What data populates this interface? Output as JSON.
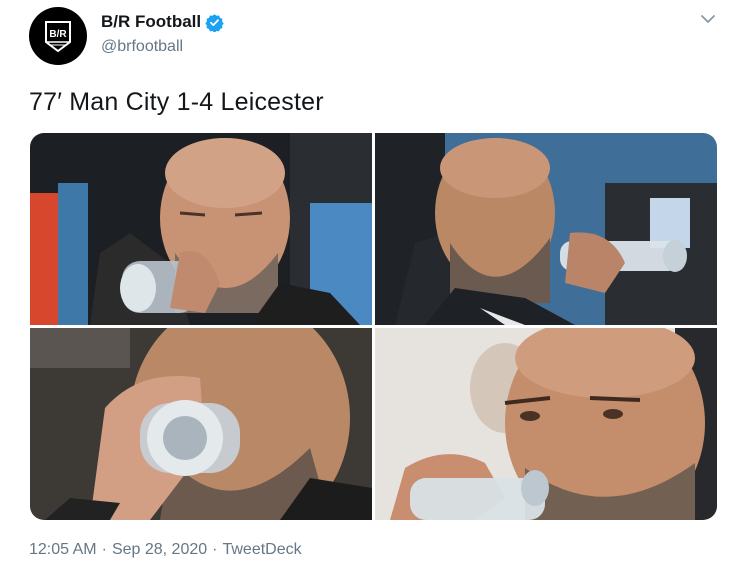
{
  "account": {
    "display_name": "B/R Football",
    "handle": "@brfootball",
    "verified": true,
    "avatar_icon": "br-logo-icon",
    "logo_text": "B/R"
  },
  "tweet": {
    "text": "77′ Man City 1-4 Leicester"
  },
  "media": {
    "photos": [
      {
        "alt": "photo-1"
      },
      {
        "alt": "photo-2"
      },
      {
        "alt": "photo-3"
      },
      {
        "alt": "photo-4"
      }
    ]
  },
  "meta": {
    "time": "12:05 AM",
    "separator1": "·",
    "date": "Sep 28, 2020",
    "separator2": "·",
    "source": "TweetDeck"
  },
  "colors": {
    "verified_blue": "#1da1f2",
    "secondary_text": "#657786",
    "primary_text": "#14171a"
  }
}
